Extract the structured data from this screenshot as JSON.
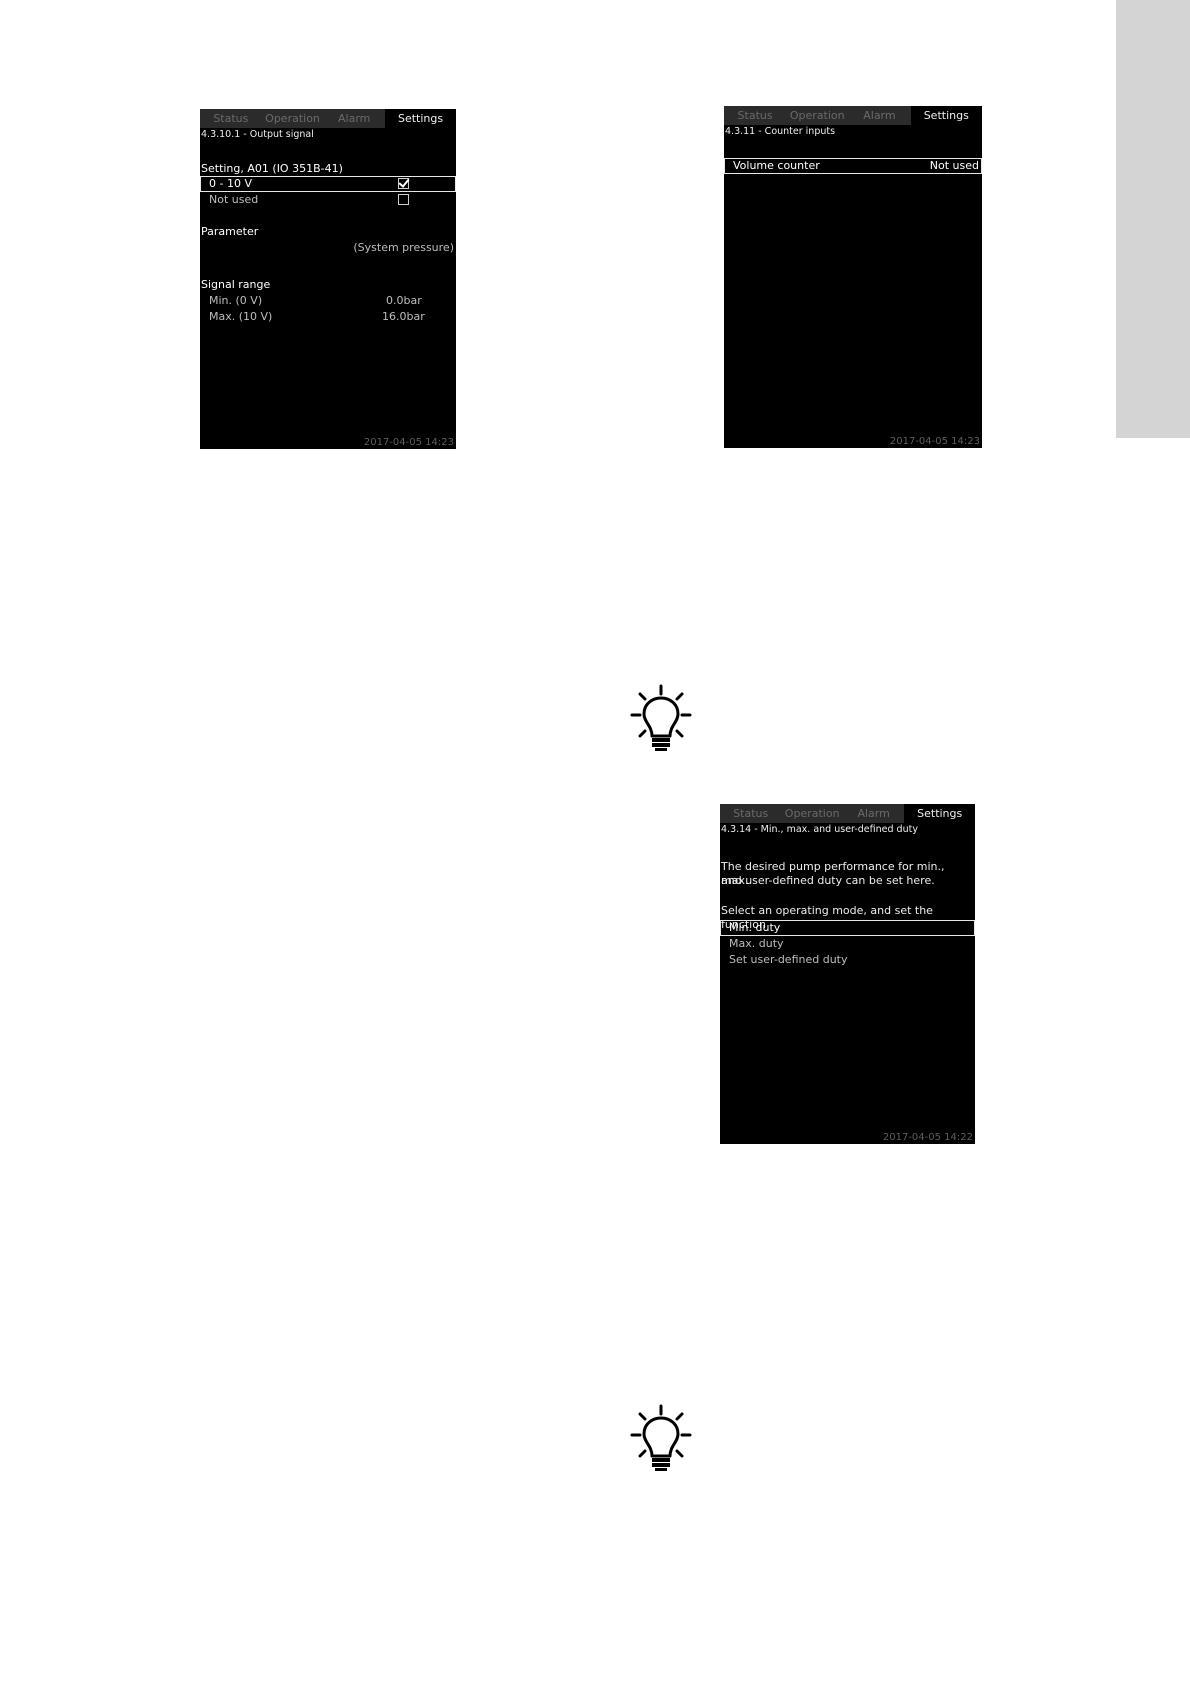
{
  "tabs": [
    "Status",
    "Operation",
    "Alarm",
    "Settings"
  ],
  "screen1": {
    "crumb": "4.3.10.1 - Output signal",
    "setting_heading": "Setting, A01 (IO 351B-41)",
    "options": [
      {
        "label": "0 - 10 V",
        "checked": true
      },
      {
        "label": "Not used",
        "checked": false
      }
    ],
    "parameter_heading": "Parameter",
    "parameter_value": "(System pressure)",
    "range_heading": "Signal range",
    "range_min_label": "Min. (0 V)",
    "range_min_value": "0.0bar",
    "range_max_label": "Max. (10 V)",
    "range_max_value": "16.0bar",
    "timestamp": "2017-04-05 14:23"
  },
  "screen2": {
    "crumb": "4.3.11 - Counter inputs",
    "row_label": "Volume counter",
    "row_value": "Not used",
    "timestamp": "2017-04-05 14:23"
  },
  "screen3": {
    "crumb": "4.3.14 - Min., max. and user-defined duty",
    "description_line1": "The desired pump performance for min., max.",
    "description_line2": "and user-defined duty can be set here.",
    "instruction": "Select an operating mode, and set the function",
    "items": [
      "Min. duty",
      "Max. duty",
      "Set user-defined duty"
    ],
    "timestamp": "2017-04-05 14:22"
  },
  "icons": [
    "tip-lightbulb-icon",
    "tip-lightbulb-icon"
  ]
}
